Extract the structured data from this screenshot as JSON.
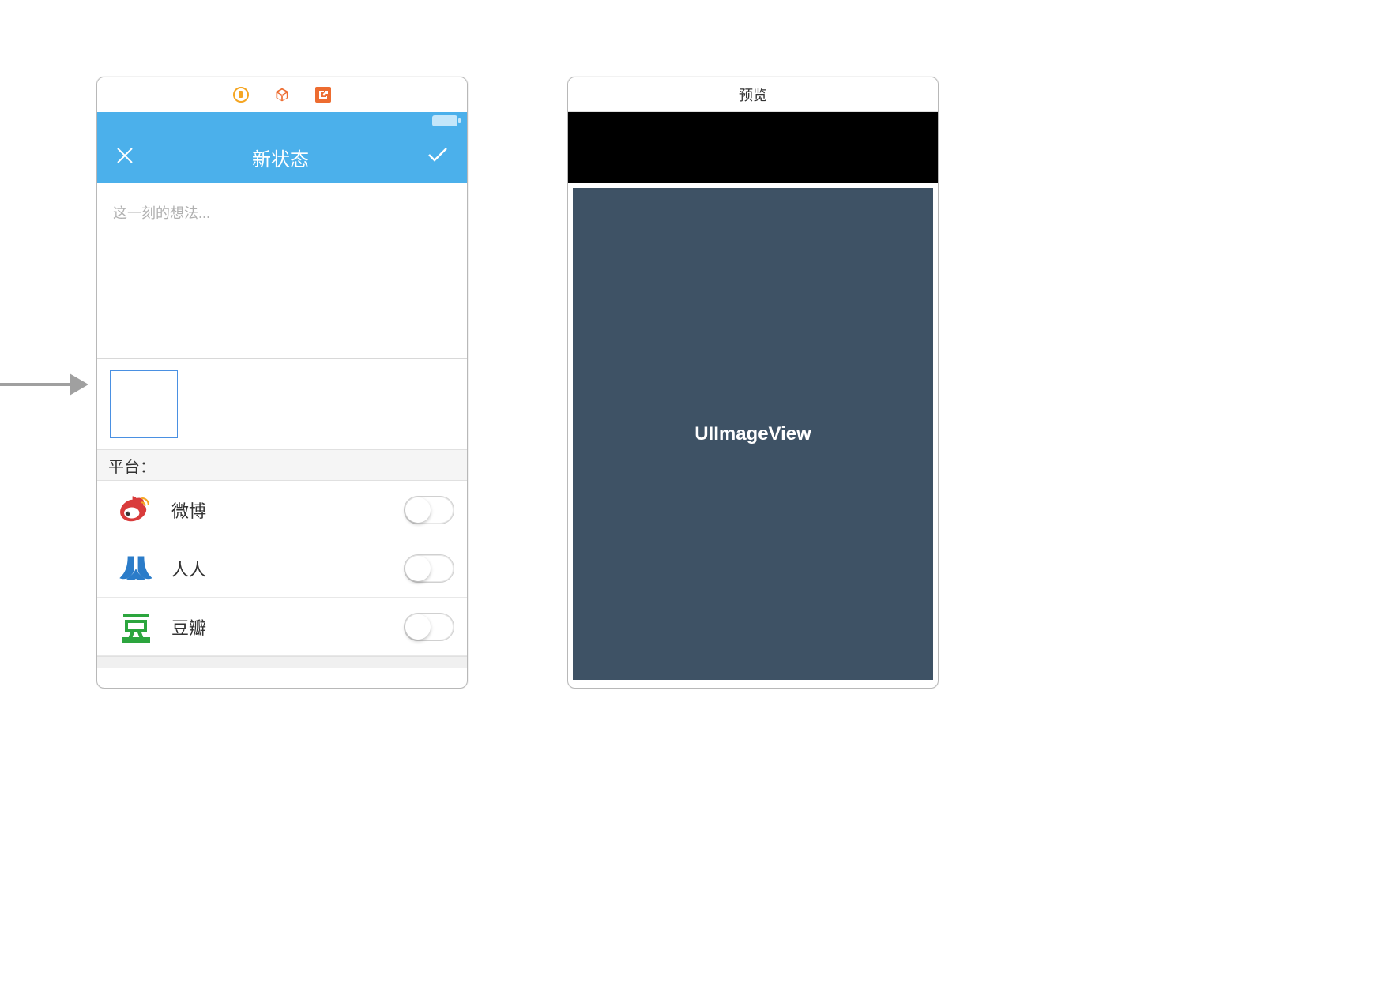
{
  "left_screen": {
    "nav": {
      "title": "新状态"
    },
    "compose": {
      "placeholder": "这一刻的想法..."
    },
    "platforms": {
      "header": "平台：",
      "items": [
        {
          "name": "微博",
          "icon": "weibo",
          "enabled": false
        },
        {
          "name": "人人",
          "icon": "renren",
          "enabled": false
        },
        {
          "name": "豆瓣",
          "icon": "douban",
          "enabled": false
        }
      ]
    }
  },
  "right_screen": {
    "header": "预览",
    "imageview_label": "UIImageView"
  }
}
